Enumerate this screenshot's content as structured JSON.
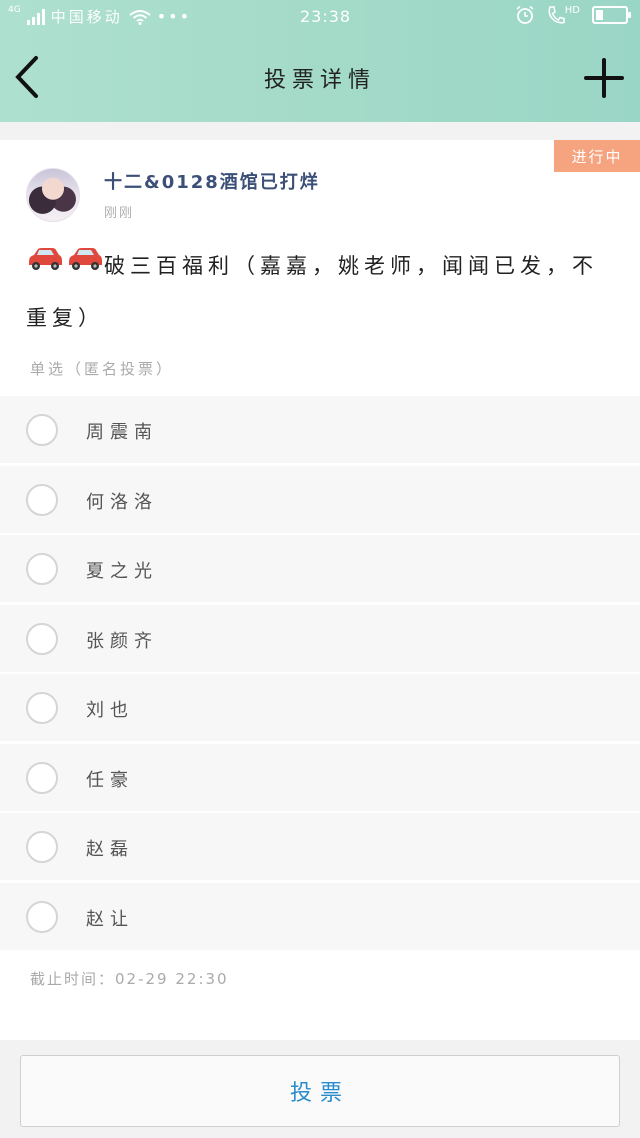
{
  "statusbar": {
    "network": "4G",
    "carrier": "中国移动",
    "more": "•••",
    "time": "23:38",
    "hd": "HD"
  },
  "navbar": {
    "title": "投票详情",
    "back_icon": "chevron-left-icon",
    "add_icon": "plus-icon"
  },
  "post": {
    "badge": "进行中",
    "username": "十二&0128酒馆已打烊",
    "time": "刚刚",
    "emoji": "car-icon",
    "text": "破三百福利（嘉嘉，姚老师，闻闻已发，不重复）"
  },
  "vote": {
    "type_label": "单选（匿名投票）",
    "options": [
      {
        "label": "周震南"
      },
      {
        "label": "何洛洛"
      },
      {
        "label": "夏之光"
      },
      {
        "label": "张颜齐"
      },
      {
        "label": "刘也"
      },
      {
        "label": "任豪"
      },
      {
        "label": "赵磊"
      },
      {
        "label": "赵让"
      }
    ],
    "deadline": "截止时间：02-29 22:30",
    "submit_label": "投票"
  },
  "colors": {
    "header_bg": "#a4dac8",
    "badge_bg": "#f6a37f",
    "username": "#3b4f78",
    "button_text": "#2a8ccc"
  }
}
